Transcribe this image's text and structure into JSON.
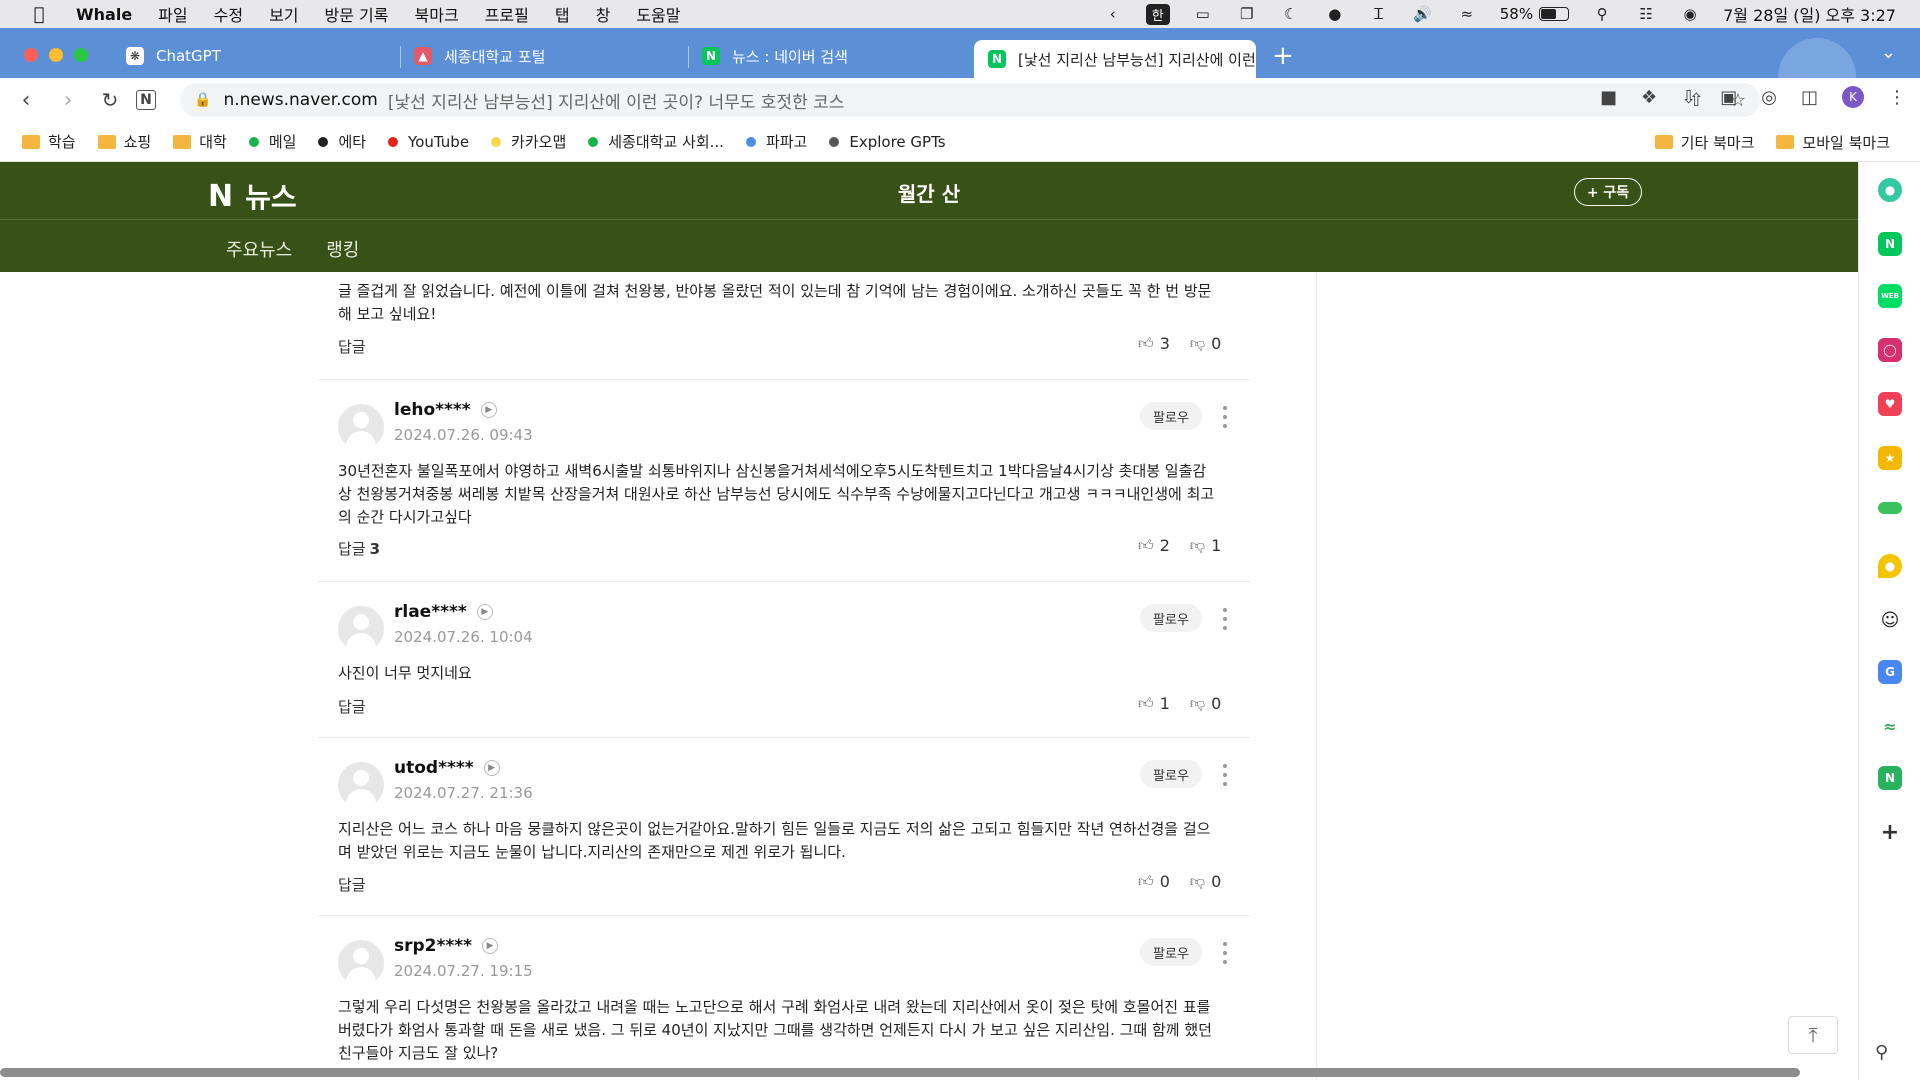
{
  "menubar": {
    "app": "Whale",
    "items": [
      "파일",
      "수정",
      "보기",
      "방문 기록",
      "북마크",
      "프로필",
      "탭",
      "창",
      "도움말"
    ],
    "ime": "한",
    "battery": "58%",
    "battery_level": 0.58,
    "datetime": "7월 28일 (일) 오후 3:27"
  },
  "tabs": [
    {
      "label": "ChatGPT",
      "icon": "chatgpt-icon",
      "color": "#ffffff"
    },
    {
      "label": "세종대학교 포털",
      "icon": "sejong-icon",
      "color": "#e05a6a"
    },
    {
      "label": "뉴스 : 네이버 검색",
      "icon": "naver-icon",
      "color": "#03c75a"
    },
    {
      "label": "[낯선 지리산 남부능선] 지리산에 이런",
      "icon": "naver-icon",
      "color": "#03c75a"
    }
  ],
  "address": {
    "host": "n.news.naver.com",
    "title": "[낯선 지리산 남부능선] 지리산에 이런 곳이? 너무도 호젓한 코스"
  },
  "bookmarks": [
    {
      "label": "학습",
      "kind": "folder"
    },
    {
      "label": "쇼핑",
      "kind": "folder"
    },
    {
      "label": "대학",
      "kind": "folder"
    },
    {
      "label": "메일",
      "kind": "dot",
      "color": "#19b34c"
    },
    {
      "label": "에타",
      "kind": "dot",
      "color": "#222222"
    },
    {
      "label": "YouTube",
      "kind": "dot",
      "color": "#e62117"
    },
    {
      "label": "카카오맵",
      "kind": "dot",
      "color": "#f7d84a"
    },
    {
      "label": "세종대학교 사회...",
      "kind": "dot",
      "color": "#19b34c"
    },
    {
      "label": "파파고",
      "kind": "dot",
      "color": "#4a90e2"
    },
    {
      "label": "Explore GPTs",
      "kind": "dot",
      "color": "#555555"
    }
  ],
  "bookmarks_right": [
    "기타 북마크",
    "모바일 북마크"
  ],
  "naver": {
    "logo_n": "N",
    "logo_text": "뉴스",
    "press": "월간 산",
    "subscribe": "+ 구독",
    "tabs": [
      "주요뉴스",
      "랭킹"
    ],
    "header_color": "#385116"
  },
  "comments": [
    {
      "nick": "",
      "date": "",
      "body": "글 즐겁게 잘 읽었습니다. 예전에 이틀에 걸쳐 천왕봉, 반야봉 올랐던 적이 있는데 참 기억에 남는 경험이에요. 소개하신 곳들도 꼭 한 번 방문해 보고 싶네요!",
      "reply": "답글",
      "reply_count": "",
      "likes": "3",
      "dislikes": "0"
    },
    {
      "nick": "leho****",
      "date": "2024.07.26. 09:43",
      "follow": "팔로우",
      "body": "30년전혼자 불일폭포에서 야영하고 새벽6시출발 쇠통바위지나 삼신봉을거쳐세석에오후5시도착텐트치고 1박다음날4시기상 촛대봉 일출감상 천왕봉거쳐중봉 써레봉 치밭목 산장을거쳐 대원사로 하산 남부능선 당시에도 식수부족 수낭에물지고다닌다고 개고생 ㅋㅋㅋ내인생에 최고의 순간 다시가고싶다",
      "reply": "답글",
      "reply_count": "3",
      "likes": "2",
      "dislikes": "1"
    },
    {
      "nick": "rlae****",
      "date": "2024.07.26. 10:04",
      "follow": "팔로우",
      "body": "사진이 너무 멋지네요",
      "reply": "답글",
      "reply_count": "",
      "likes": "1",
      "dislikes": "0"
    },
    {
      "nick": "utod****",
      "date": "2024.07.27. 21:36",
      "follow": "팔로우",
      "body": "지리산은 어느 코스 하나 마음 뭉클하지 않은곳이 없는거같아요.말하기 힘든 일들로 지금도 저의 삶은 고되고 힘들지만 작년 연하선경을 걸으며 받았던 위로는 지금도 눈물이 납니다.지리산의 존재만으로 제겐 위로가 됩니다.",
      "reply": "답글",
      "reply_count": "",
      "likes": "0",
      "dislikes": "0"
    },
    {
      "nick": "srp2****",
      "date": "2024.07.27. 19:15",
      "follow": "팔로우",
      "body": "그렇게 우리 다섯명은 천왕봉을 올라갔고 내려올 때는 노고단으로 해서 구례 화엄사로 내려 왔는데 지리산에서 옷이 젖은 탓에 호몰어진 표를 버렸다가 화엄사 통과할 때 돈을 새로 냈음. 그 뒤로 40년이 지났지만 그때를 생각하면 언제든지 다시 가 보고 싶은 지리산임. 그때 함께 했던 친구들아 지금도 잘 있나?",
      "reply": "답글",
      "reply_count": "",
      "likes": "",
      "dislikes": ""
    }
  ],
  "rail_icons": [
    {
      "name": "whale-home-icon",
      "color": "#32c8a0"
    },
    {
      "name": "naver-icon",
      "color": "#03c75a"
    },
    {
      "name": "webtoon-icon",
      "color": "#00dc64"
    },
    {
      "name": "instagram-icon",
      "color": "#d6306f"
    },
    {
      "name": "pocket-icon",
      "color": "#ef4056"
    },
    {
      "name": "favorites-star-icon",
      "color": "#f5b800"
    },
    {
      "name": "card-icon",
      "color": "#3bc15c"
    },
    {
      "name": "map-pin-icon",
      "color": "#f5c400"
    },
    {
      "name": "smile-icon",
      "color": "#222222"
    },
    {
      "name": "translate-icon",
      "color": "#4a86f0"
    },
    {
      "name": "chart-icon",
      "color": "#38b05e"
    },
    {
      "name": "naver-bag-icon",
      "color": "#27b25d"
    },
    {
      "name": "add-icon",
      "color": "#555555"
    }
  ]
}
